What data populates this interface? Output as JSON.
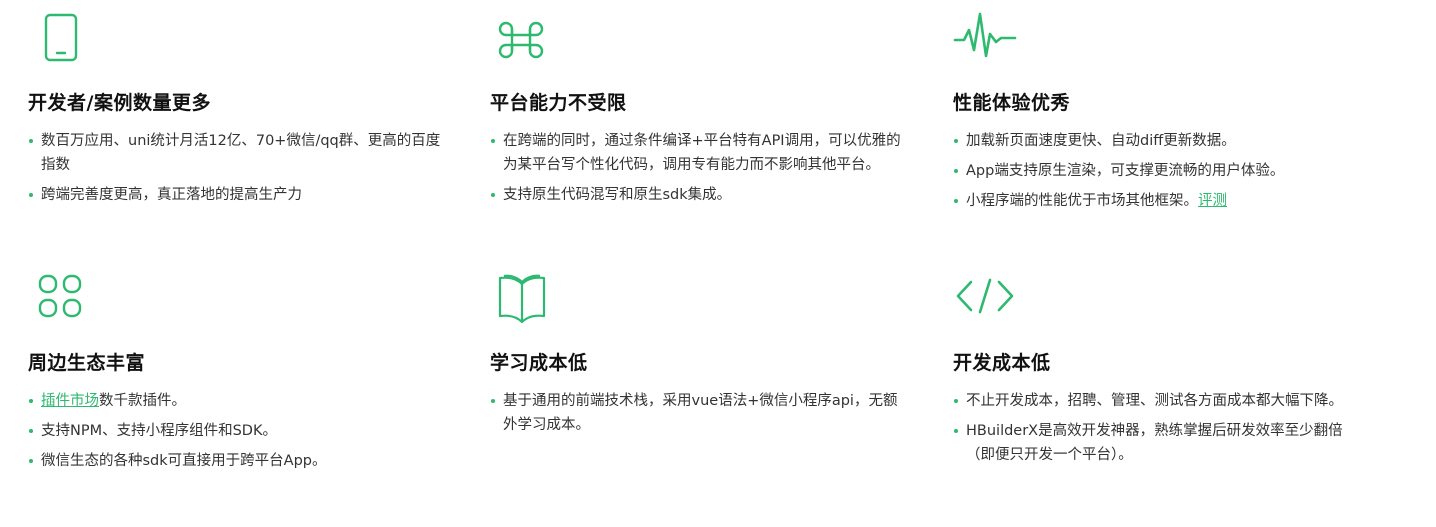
{
  "accent_color": "#2db96f",
  "features": [
    {
      "icon": "tablet-icon",
      "title": "开发者/案例数量更多",
      "points": [
        {
          "text": "数百万应用、uni统计月活12亿、70+微信/qq群、更高的百度指数"
        },
        {
          "text": "跨端完善度更高，真正落地的提高生产力"
        }
      ]
    },
    {
      "icon": "command-icon",
      "title": "平台能力不受限",
      "points": [
        {
          "text": "在跨端的同时，通过条件编译+平台特有API调用，可以优雅的为某平台写个性化代码，调用专有能力而不影响其他平台。"
        },
        {
          "text": "支持原生代码混写和原生sdk集成。"
        }
      ]
    },
    {
      "icon": "pulse-icon",
      "title": "性能体验优秀",
      "points": [
        {
          "text": "加载新页面速度更快、自动diff更新数据。"
        },
        {
          "text": "App端支持原生渲染，可支撑更流畅的用户体验。"
        },
        {
          "text": "小程序端的性能优于市场其他框架。",
          "link": "评测"
        }
      ]
    },
    {
      "icon": "grid-icon",
      "title": "周边生态丰富",
      "points": [
        {
          "link": "插件市场",
          "text": "数千款插件。"
        },
        {
          "text": "支持NPM、支持小程序组件和SDK。"
        },
        {
          "text": "微信生态的各种sdk可直接用于跨平台App。"
        }
      ]
    },
    {
      "icon": "book-icon",
      "title": "学习成本低",
      "points": [
        {
          "text": "基于通用的前端技术栈，采用vue语法+微信小程序api，无额外学习成本。"
        }
      ]
    },
    {
      "icon": "code-icon",
      "title": "开发成本低",
      "points": [
        {
          "text": "不止开发成本，招聘、管理、测试各方面成本都大幅下降。"
        },
        {
          "text": "HBuilderX是高效开发神器，熟练掌握后研发效率至少翻倍（即便只开发一个平台）。"
        }
      ]
    }
  ]
}
